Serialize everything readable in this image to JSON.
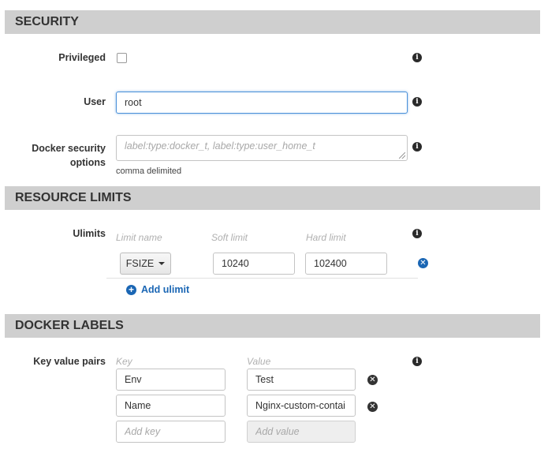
{
  "security": {
    "title": "SECURITY",
    "privileged_label": "Privileged",
    "privileged_checked": false,
    "user_label": "User",
    "user_value": "root",
    "docker_security_label_line1": "Docker security",
    "docker_security_label_line2": "options",
    "docker_security_placeholder": "label:type:docker_t, label:type:user_home_t",
    "docker_security_hint": "comma delimited"
  },
  "resource_limits": {
    "title": "RESOURCE LIMITS",
    "ulimits_label": "Ulimits",
    "columns": [
      "Limit name",
      "Soft limit",
      "Hard limit"
    ],
    "rows": [
      {
        "name": "FSIZE",
        "soft": "10240",
        "hard": "102400"
      }
    ],
    "add_label": "Add ulimit"
  },
  "docker_labels": {
    "title": "DOCKER LABELS",
    "pairs_label": "Key value pairs",
    "columns": [
      "Key",
      "Value"
    ],
    "rows": [
      {
        "key": "Env",
        "value": "Test"
      },
      {
        "key": "Name",
        "value": "Nginx-custom-contai"
      }
    ],
    "new_key_placeholder": "Add key",
    "new_value_placeholder": "Add value"
  },
  "icons": {
    "info": "info-icon",
    "remove": "remove-icon",
    "add": "plus-icon",
    "caret": "caret-down-icon"
  },
  "colors": {
    "section_bar": "#cfcfcf",
    "link_blue": "#1a66b4",
    "focus_border": "#4a90d9"
  }
}
